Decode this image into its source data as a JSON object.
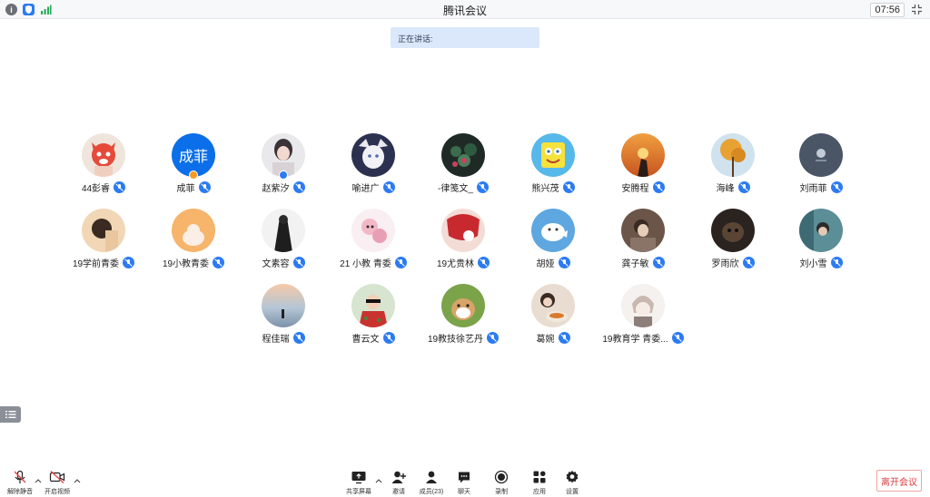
{
  "window": {
    "title": "腾讯会议",
    "clock": "07:56"
  },
  "banner": {
    "speaking": "正在讲话:"
  },
  "participants": [
    {
      "name": "44彭睿",
      "avatar": "fox-photo",
      "badge": ""
    },
    {
      "name": "成菲",
      "avatar": "text",
      "avatar_text": "成菲",
      "badge": "host"
    },
    {
      "name": "赵紫汐",
      "avatar": "girl-photo",
      "badge": "cohost"
    },
    {
      "name": "喻进广",
      "avatar": "anime-photo",
      "badge": ""
    },
    {
      "name": "-律笺文_",
      "avatar": "flower-photo",
      "badge": ""
    },
    {
      "name": "熊兴茂",
      "avatar": "sponge-photo",
      "badge": ""
    },
    {
      "name": "安腾程",
      "avatar": "sunset-photo",
      "badge": ""
    },
    {
      "name": "海峰",
      "avatar": "tree-photo",
      "badge": ""
    },
    {
      "name": "刘雨菲",
      "avatar": "dark-photo",
      "badge": ""
    },
    {
      "name": "19学前青委",
      "avatar": "girl2-photo",
      "badge": ""
    },
    {
      "name": "19小教青委",
      "avatar": "cartoon-photo",
      "badge": ""
    },
    {
      "name": "文素容",
      "avatar": "ink-photo",
      "badge": ""
    },
    {
      "name": "21 小教 青委",
      "avatar": "anime2-photo",
      "badge": ""
    },
    {
      "name": "19尤贵林",
      "avatar": "red-photo",
      "badge": ""
    },
    {
      "name": "胡娅",
      "avatar": "seal-photo",
      "badge": ""
    },
    {
      "name": "龚子敏",
      "avatar": "portrait-photo",
      "badge": ""
    },
    {
      "name": "罗雨欣",
      "avatar": "dog-dark-photo",
      "badge": ""
    },
    {
      "name": "刘小雪",
      "avatar": "teal-photo",
      "badge": ""
    },
    {
      "name": "程佳瑞",
      "avatar": "sea-photo",
      "badge": ""
    },
    {
      "name": "曹云文",
      "avatar": "kid-photo",
      "badge": ""
    },
    {
      "name": "19教技徐艺丹",
      "avatar": "shiba-photo",
      "badge": ""
    },
    {
      "name": "葛婉",
      "avatar": "food-photo",
      "badge": ""
    },
    {
      "name": "19教育学 青委...",
      "avatar": "sketch-photo",
      "badge": ""
    }
  ],
  "toolbar": {
    "unmute": "解除静音",
    "start_video": "开启视频",
    "share_screen": "共享屏幕",
    "invite": "邀请",
    "members": "成员(23)",
    "chat": "聊天",
    "record": "录制",
    "apps": "应用",
    "settings": "设置",
    "leave": "离开会议"
  },
  "colors": {
    "accent": "#2c7bf2",
    "leave": "#d93d3d",
    "banner": "#dbe8fb"
  }
}
